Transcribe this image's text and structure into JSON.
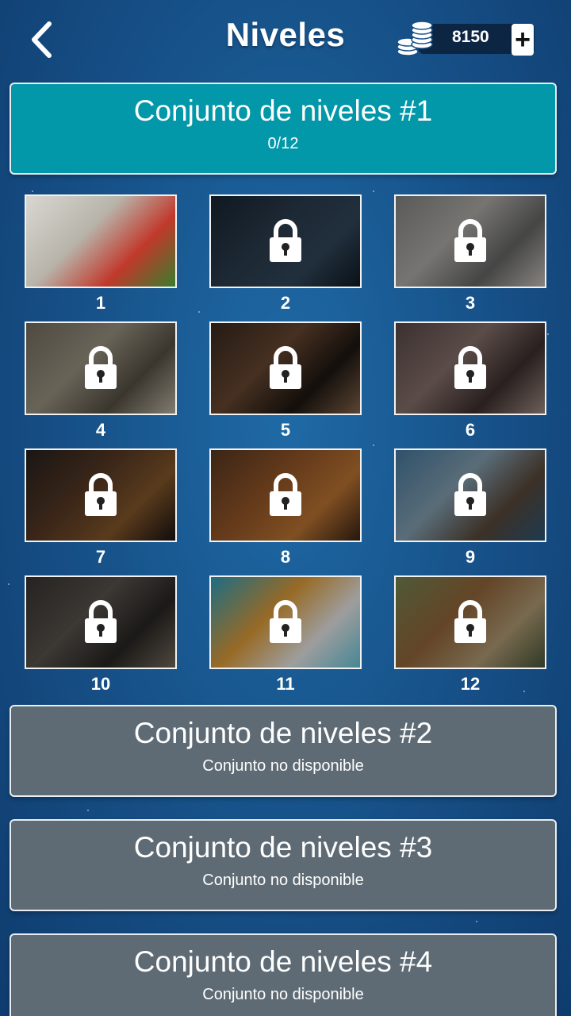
{
  "header": {
    "title": "Niveles",
    "coins": "8150",
    "plus": "+"
  },
  "sets": [
    {
      "title": "Conjunto de niveles #1",
      "subtitle": "0/12"
    },
    {
      "title": "Conjunto de niveles #2",
      "subtitle": "Conjunto no disponible"
    },
    {
      "title": "Conjunto de niveles #3",
      "subtitle": "Conjunto no disponible"
    },
    {
      "title": "Conjunto de niveles #4",
      "subtitle": "Conjunto no disponible"
    }
  ],
  "levels": [
    {
      "num": "1",
      "locked": false
    },
    {
      "num": "2",
      "locked": true
    },
    {
      "num": "3",
      "locked": true
    },
    {
      "num": "4",
      "locked": true
    },
    {
      "num": "5",
      "locked": true
    },
    {
      "num": "6",
      "locked": true
    },
    {
      "num": "7",
      "locked": true
    },
    {
      "num": "8",
      "locked": true
    },
    {
      "num": "9",
      "locked": true
    },
    {
      "num": "10",
      "locked": true
    },
    {
      "num": "11",
      "locked": true
    },
    {
      "num": "12",
      "locked": true
    }
  ],
  "colors": {
    "active_set": "#0398a9",
    "locked_set": "#5e6b74",
    "background": "#164f86"
  }
}
